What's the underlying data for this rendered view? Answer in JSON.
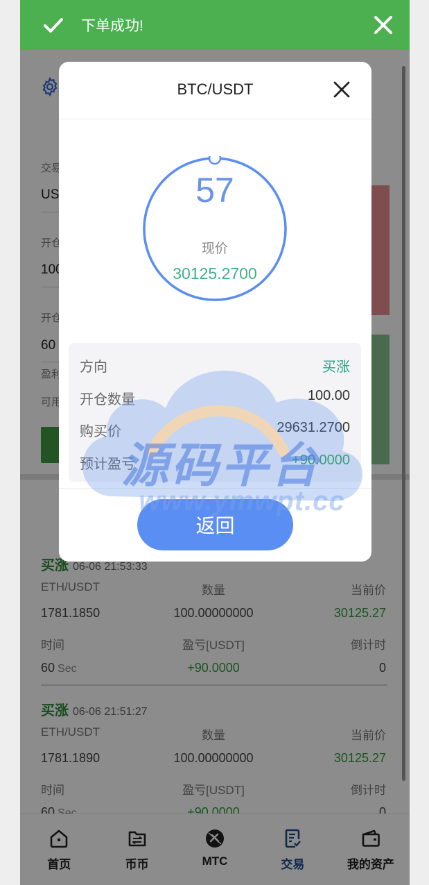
{
  "toast": {
    "message": "下单成功!"
  },
  "page": {
    "form": {
      "label_1": "交易",
      "value_1": "US",
      "label_2": "开仓",
      "value_2": "100",
      "label_3": "开仓",
      "value_3": "60",
      "label_4": "盈利",
      "label_5": "可用"
    },
    "records": [
      {
        "direction": "买涨",
        "time": "06-06 21:53:33",
        "pair": "ETH/USDT",
        "qty_label": "数量",
        "cur_label": "当前价",
        "open_price": "1781.1850",
        "qty": "100.00000000",
        "current_price": "30125.27",
        "time_label": "时间",
        "pnl_label": "盈亏[USDT]",
        "countdown_label": "倒计时",
        "duration": "60",
        "duration_unit": "Sec",
        "pnl": "+90.0000",
        "countdown": "0"
      },
      {
        "direction": "买涨",
        "time": "06-06 21:51:27",
        "pair": "ETH/USDT",
        "qty_label": "数量",
        "cur_label": "当前价",
        "open_price": "1781.1890",
        "qty": "100.00000000",
        "current_price": "30125.27",
        "time_label": "时间",
        "pnl_label": "盈亏[USDT]",
        "countdown_label": "倒计时",
        "duration": "60",
        "duration_unit": "Sec",
        "pnl": "+90.0000",
        "countdown": "0"
      }
    ]
  },
  "modal": {
    "title": "BTC/USDT",
    "countdown": "57",
    "countdown_fraction": 0.95,
    "price_label": "现价",
    "price": "30125.2700",
    "rows": [
      {
        "key": "方向",
        "value": "买涨"
      },
      {
        "key": "开仓数量",
        "value": "100.00"
      },
      {
        "key": "购买价",
        "value": "29631.2700"
      },
      {
        "key": "预计盈亏",
        "value": "+90.0000"
      }
    ],
    "back_label": "返回"
  },
  "watermark": {
    "text": "源码平台",
    "url": "www.ymwpt.cc"
  },
  "tabbar": [
    {
      "label": "首页",
      "icon": "home-icon"
    },
    {
      "label": "币币",
      "icon": "exchange-icon"
    },
    {
      "label": "MTC",
      "icon": "mtc-icon"
    },
    {
      "label": "交易",
      "icon": "trade-icon",
      "active": true
    },
    {
      "label": "我的资产",
      "icon": "wallet-icon"
    }
  ],
  "colors": {
    "toast_bg": "#4cb050",
    "accent_blue": "#5b8ef2",
    "buy_green": "#2e8b3a",
    "teal": "#1fa88a"
  }
}
